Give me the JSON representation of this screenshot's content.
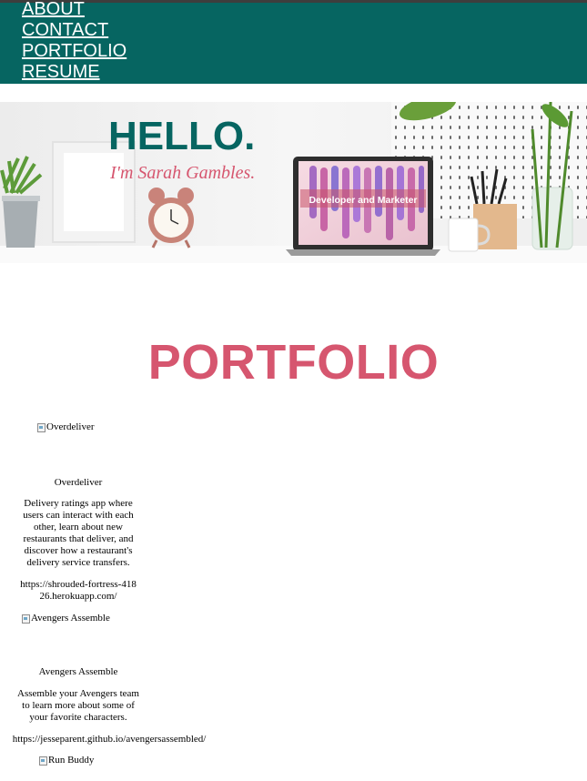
{
  "nav": {
    "items": [
      {
        "label": "ABOUT"
      },
      {
        "label": "CONTACT"
      },
      {
        "label": "PORTFOLIO"
      },
      {
        "label": "RESUME"
      }
    ]
  },
  "banner": {
    "hello": "HELLO.",
    "name": "I'm Sarah Gambles.",
    "screen_caption": "Developer and Marketer"
  },
  "section_title": "PORTFOLIO",
  "projects": [
    {
      "image_alt": "Overdeliver",
      "title": "Overdeliver",
      "description": "Delivery ratings app where users can interact with each other, learn about new restaurants that deliver, and discover how a restaurant's delivery service transfers.",
      "url": "https://shrouded-fortress-41826.herokuapp.com/"
    },
    {
      "image_alt": "Avengers Assemble",
      "title": "Avengers Assemble",
      "description": "Assemble your Avengers team to learn more about some of your favorite characters.",
      "url": "https://jesseparent.github.io/avengersassembled/"
    },
    {
      "image_alt": "Run Buddy"
    }
  ],
  "colors": {
    "header_bg": "#066561",
    "title_pink": "#d6566f",
    "hello_teal": "#066561"
  }
}
